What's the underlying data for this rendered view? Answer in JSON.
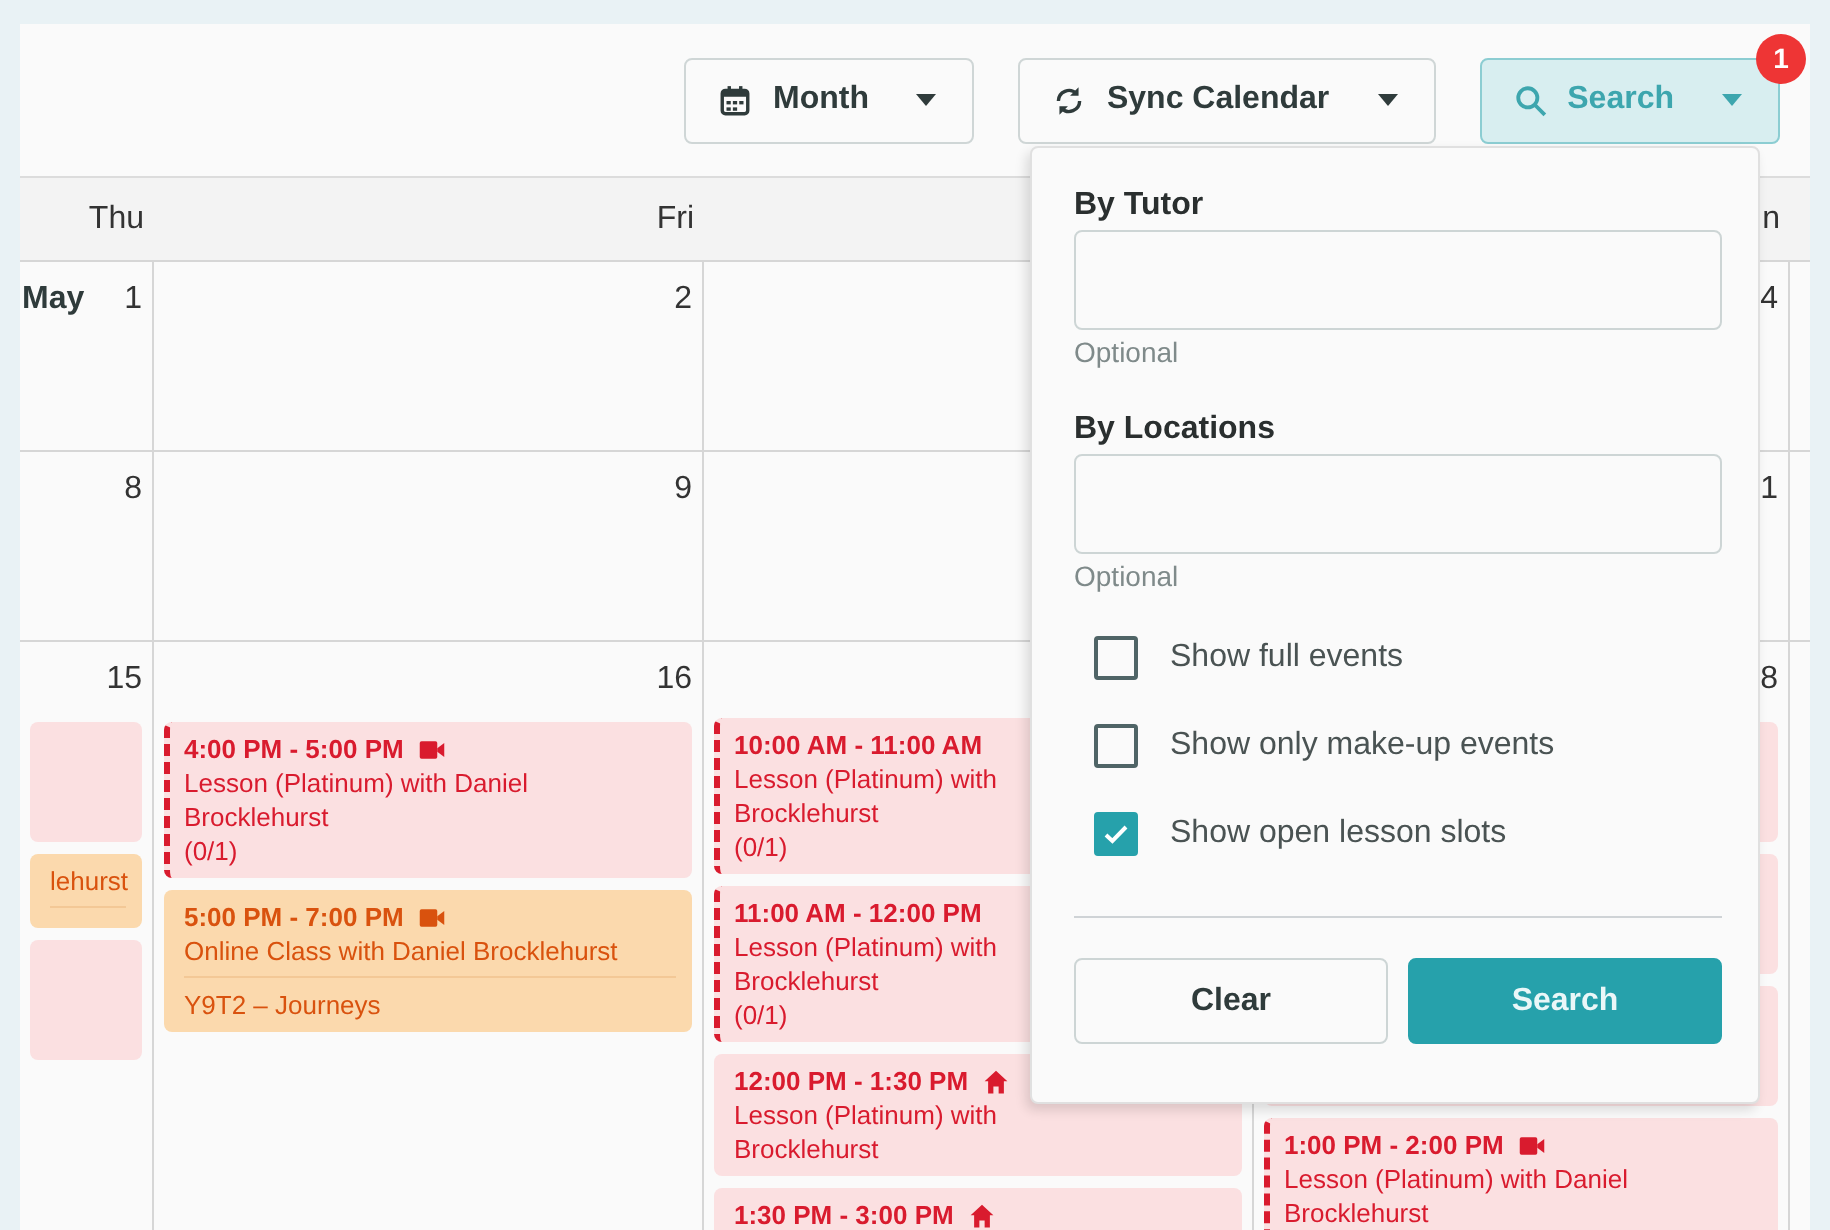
{
  "toolbar": {
    "buttons": [
      {
        "kind": "view",
        "label": "Month",
        "active": false
      },
      {
        "kind": "sync",
        "label": "Sync Calendar",
        "active": false
      },
      {
        "kind": "search",
        "label": "Search",
        "active": true,
        "badge": "1"
      }
    ]
  },
  "calendar": {
    "columns": [
      {
        "header": "Thu"
      },
      {
        "header": "Fri"
      },
      {},
      {
        "header": "n"
      }
    ],
    "weeks": [
      {
        "cells": [
          {
            "month": "May",
            "day": "1"
          },
          {
            "day": "2"
          },
          {},
          {
            "day": "4"
          }
        ]
      },
      {
        "cells": [
          {
            "day": "8"
          },
          {
            "day": "9"
          },
          {},
          {
            "day": "1"
          }
        ]
      },
      {
        "cells": [
          {
            "day": "15",
            "events": [
              {
                "kind": "blank_lesson",
                "color": "#fbe0e1",
                "open_slot": false
              },
              {
                "kind": "class",
                "color": "#fbd9ad",
                "lines": [
                  "lehurst"
                ]
              },
              {
                "kind": "blank_lesson",
                "color": "#fbe0e1",
                "open_slot": false
              }
            ]
          },
          {
            "day": "16",
            "events": [
              {
                "kind": "online_lesson",
                "color": "#fbe0e1",
                "open_slot": true,
                "time": "4:00 PM - 5:00 PM",
                "lines": [
                  "Lesson (Platinum) with Daniel",
                  "Brocklehurst",
                  "(0/1)"
                ]
              },
              {
                "kind": "online_class",
                "color": "#fbd9ad",
                "time": "5:00 PM - 7:00 PM",
                "lines": [
                  "Online Class with Daniel Brocklehurst"
                ],
                "group": "Y9T2 – Journeys"
              }
            ]
          },
          {
            "events": [
              {
                "kind": "lesson",
                "color": "#fbe0e1",
                "open_slot": true,
                "time": "10:00 AM - 11:00 AM",
                "lines": [
                  "Lesson (Platinum) with",
                  "Brocklehurst",
                  "(0/1)"
                ]
              },
              {
                "kind": "lesson",
                "color": "#fbe0e1",
                "open_slot": true,
                "time": "11:00 AM - 12:00 PM",
                "lines": [
                  "Lesson (Platinum) with",
                  "Brocklehurst",
                  "(0/1)"
                ]
              },
              {
                "kind": "home_lesson",
                "color": "#fbe0e1",
                "open_slot": false,
                "time": "12:00 PM - 1:30 PM",
                "lines": [
                  "Lesson (Platinum) with",
                  "Brocklehurst"
                ]
              },
              {
                "kind": "home_lesson",
                "color": "#fbe0e1",
                "open_slot": false,
                "time": "1:30 PM - 3:00 PM"
              }
            ]
          },
          {
            "day": "8",
            "events": [
              {
                "kind": "blank_lesson",
                "color": "#fbe0e1"
              },
              {
                "kind": "blank_lesson",
                "color": "#fbe0e1"
              },
              {
                "kind": "blank_lesson",
                "color": "#fbe0e1"
              },
              {
                "kind": "online_lesson",
                "color": "#fbe0e1",
                "open_slot": true,
                "time": "1:00 PM - 2:00 PM",
                "lines": [
                  "Lesson (Platinum) with Daniel",
                  "Brocklehurst"
                ]
              }
            ]
          }
        ]
      }
    ]
  },
  "search_panel": {
    "fields": [
      {
        "label": "By Tutor",
        "hint": "Optional"
      },
      {
        "label": "By Locations",
        "hint": "Optional"
      }
    ],
    "checkboxes": [
      {
        "label": "Show full events",
        "checked": false
      },
      {
        "label": "Show only make-up events",
        "checked": false
      },
      {
        "label": "Show open lesson slots",
        "checked": true
      }
    ],
    "buttons": [
      {
        "kind": "secondary",
        "label": "Clear"
      },
      {
        "kind": "primary",
        "label": "Search"
      }
    ]
  }
}
